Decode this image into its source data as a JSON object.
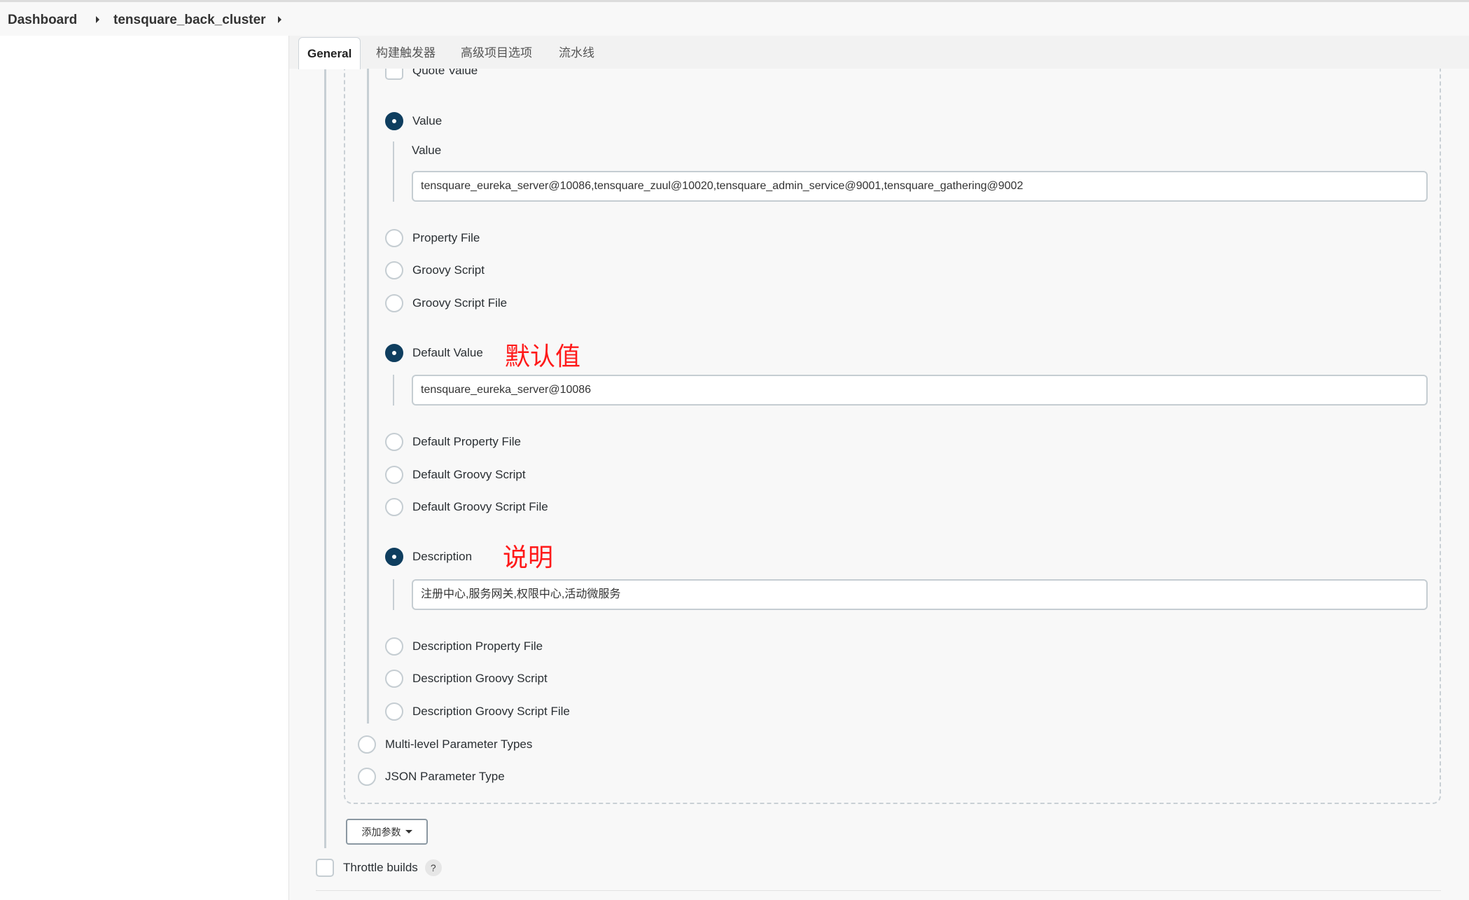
{
  "breadcrumb": {
    "items": [
      "Dashboard",
      "tensquare_back_cluster"
    ]
  },
  "tabs": [
    {
      "label": "General",
      "active": true
    },
    {
      "label": "构建触发器",
      "active": false
    },
    {
      "label": "高级项目选项",
      "active": false
    },
    {
      "label": "流水线",
      "active": false
    }
  ],
  "form": {
    "quote_value": {
      "label": "Quote Value",
      "checked": false
    },
    "value_options": [
      {
        "label": "Value",
        "checked": true
      },
      {
        "label": "Property File",
        "checked": false
      },
      {
        "label": "Groovy Script",
        "checked": false
      },
      {
        "label": "Groovy Script File",
        "checked": false
      }
    ],
    "value_field": {
      "label": "Value",
      "value": "tensquare_eureka_server@10086,tensquare_zuul@10020,tensquare_admin_service@9001,tensquare_gathering@9002"
    },
    "default_options": [
      {
        "label": "Default Value",
        "checked": true
      },
      {
        "label": "Default Property File",
        "checked": false
      },
      {
        "label": "Default Groovy Script",
        "checked": false
      },
      {
        "label": "Default Groovy Script File",
        "checked": false
      }
    ],
    "default_value_field": {
      "value": "tensquare_eureka_server@10086"
    },
    "default_annotation": "默认值",
    "description_options": [
      {
        "label": "Description",
        "checked": true
      },
      {
        "label": "Description Property File",
        "checked": false
      },
      {
        "label": "Description Groovy Script",
        "checked": false
      },
      {
        "label": "Description Groovy Script File",
        "checked": false
      }
    ],
    "description_field": {
      "value": "注册中心,服务网关,权限中心,活动微服务"
    },
    "description_annotation": "说明",
    "parameter_types": [
      {
        "label": "Multi-level Parameter Types",
        "checked": false
      },
      {
        "label": "JSON Parameter Type",
        "checked": false
      }
    ],
    "add_parameter_label": "添加参数",
    "throttle_builds": {
      "label": "Throttle builds",
      "checked": false,
      "help": "?"
    }
  }
}
